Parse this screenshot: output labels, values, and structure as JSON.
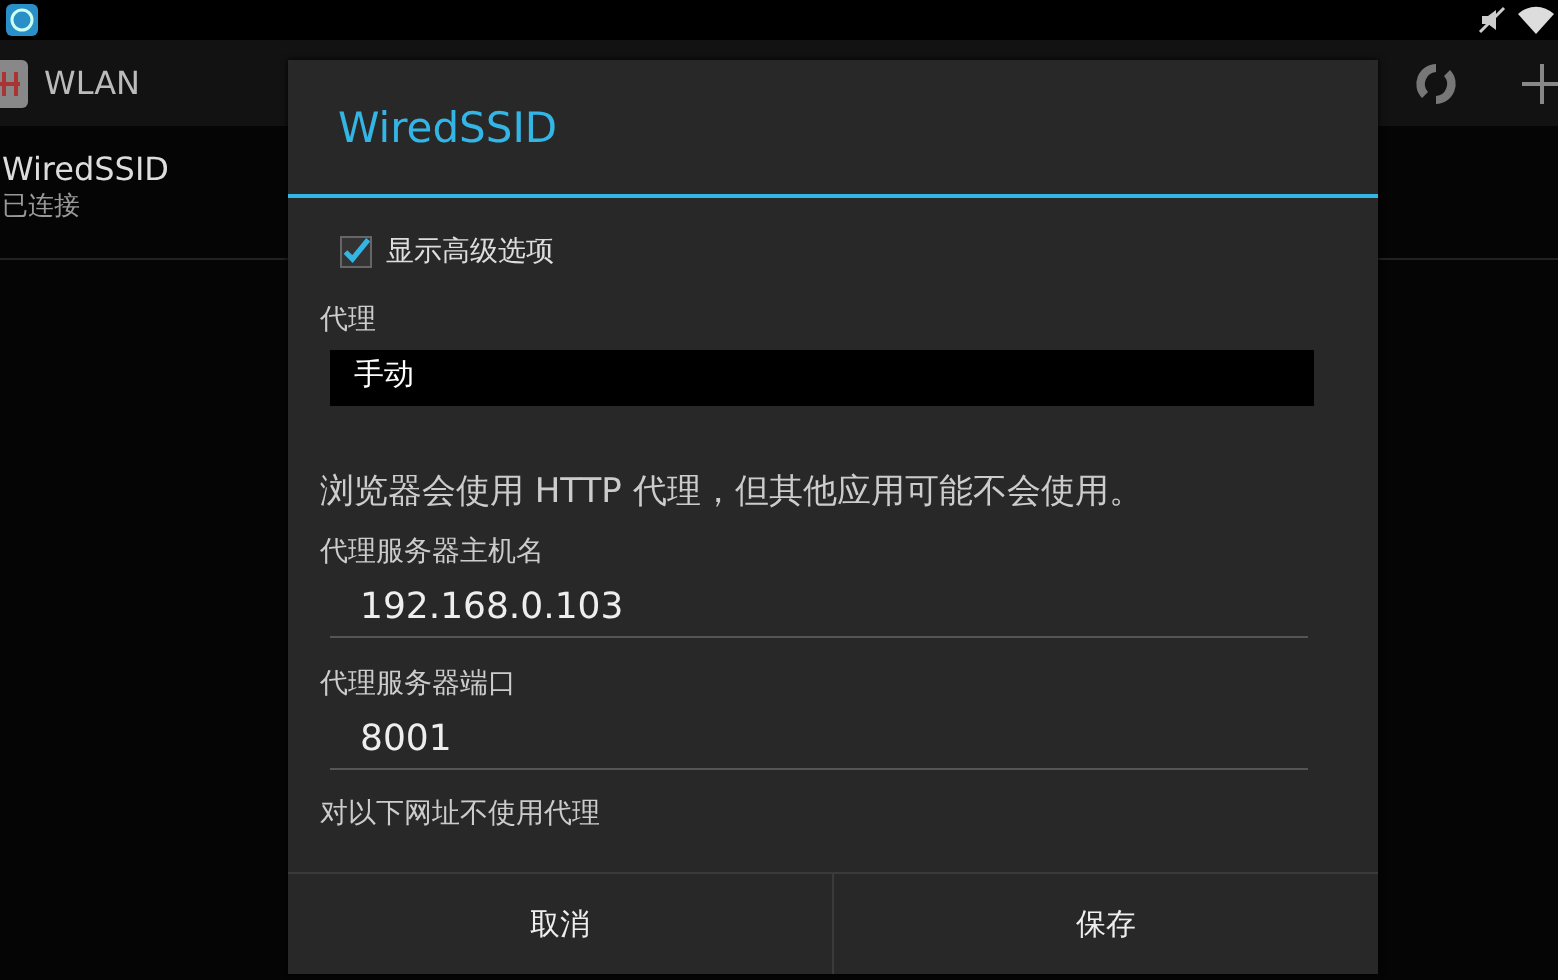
{
  "action_bar": {
    "title": "WLAN"
  },
  "networks": [
    {
      "name": "WiredSSID",
      "status": "已连接"
    }
  ],
  "dialog": {
    "title": "WiredSSID",
    "advanced": {
      "label": "显示高级选项",
      "checked": true
    },
    "proxy": {
      "label": "代理",
      "value": "手动"
    },
    "note": "浏览器会使用 HTTP 代理，但其他应用可能不会使用。",
    "host": {
      "label": "代理服务器主机名",
      "value": "192.168.0.103"
    },
    "port": {
      "label": "代理服务器端口",
      "value": "8001"
    },
    "bypass_label": "对以下网址不使用代理",
    "buttons": [
      "取消",
      "保存"
    ]
  }
}
